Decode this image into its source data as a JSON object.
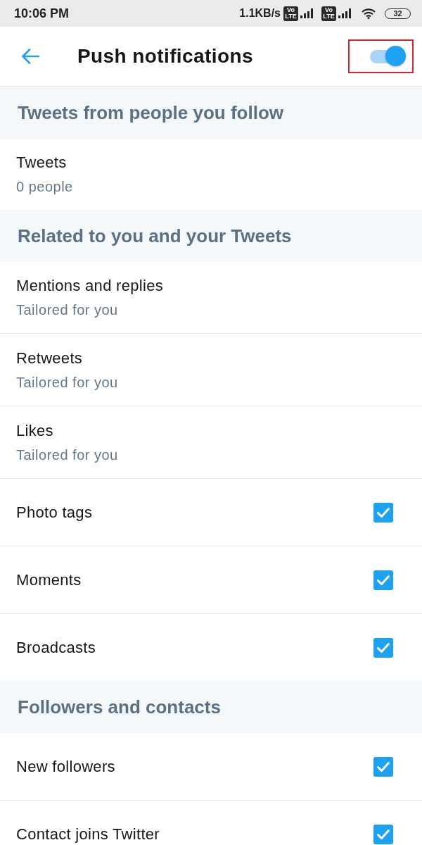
{
  "status_bar": {
    "time": "10:06 PM",
    "network_speed": "1.1KB/s",
    "sim_badges": [
      {
        "top": "Vo",
        "bottom": "LTE"
      },
      {
        "top": "Vo",
        "bottom": "LTE"
      }
    ],
    "battery": "32"
  },
  "header": {
    "title": "Push notifications",
    "toggle": {
      "on": true,
      "highlighted": true
    }
  },
  "sections": [
    {
      "title": "Tweets from people you follow",
      "items": [
        {
          "kind": "link",
          "label": "Tweets",
          "detail": "0 people"
        }
      ]
    },
    {
      "title": "Related to you and your Tweets",
      "items": [
        {
          "kind": "link",
          "label": "Mentions and replies",
          "detail": "Tailored for you"
        },
        {
          "kind": "link",
          "label": "Retweets",
          "detail": "Tailored for you"
        },
        {
          "kind": "link",
          "label": "Likes",
          "detail": "Tailored for you"
        },
        {
          "kind": "check",
          "label": "Photo tags",
          "checked": true
        },
        {
          "kind": "check",
          "label": "Moments",
          "checked": true
        },
        {
          "kind": "check",
          "label": "Broadcasts",
          "checked": true
        }
      ]
    },
    {
      "title": "Followers and contacts",
      "items": [
        {
          "kind": "check",
          "label": "New followers",
          "checked": true
        },
        {
          "kind": "check",
          "label": "Contact joins Twitter",
          "checked": true
        }
      ]
    }
  ]
}
